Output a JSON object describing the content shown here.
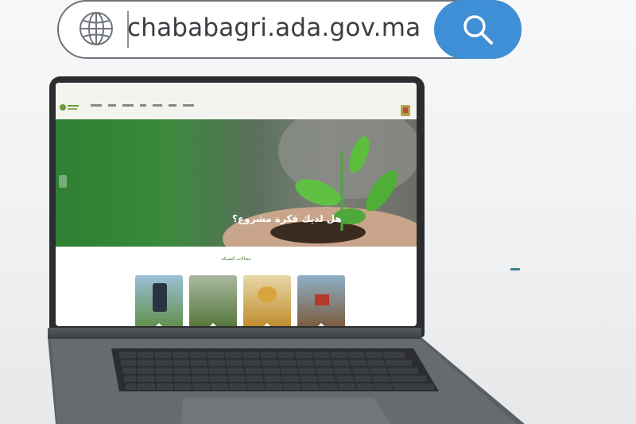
{
  "address_bar": {
    "url": "chababagri.ada.gov.ma",
    "globe_icon": "globe-icon",
    "search_icon": "magnifier-icon"
  },
  "website": {
    "hero_slogan": "هل لديك فكرة مشروع؟",
    "section_title": "مجالات الشبكة",
    "cards": [
      {
        "name": "phone-in-field",
        "color": "#6aa0c4"
      },
      {
        "name": "farmers-in-field",
        "color": "#6c8f4f"
      },
      {
        "name": "honey-jar",
        "color": "#c79a3c"
      },
      {
        "name": "tractor",
        "color": "#8a6a4a"
      }
    ]
  },
  "colors": {
    "search_button": "#3f8fd6",
    "laptop_body": "#2b2d30",
    "brand_green": "#3a8a3b"
  }
}
